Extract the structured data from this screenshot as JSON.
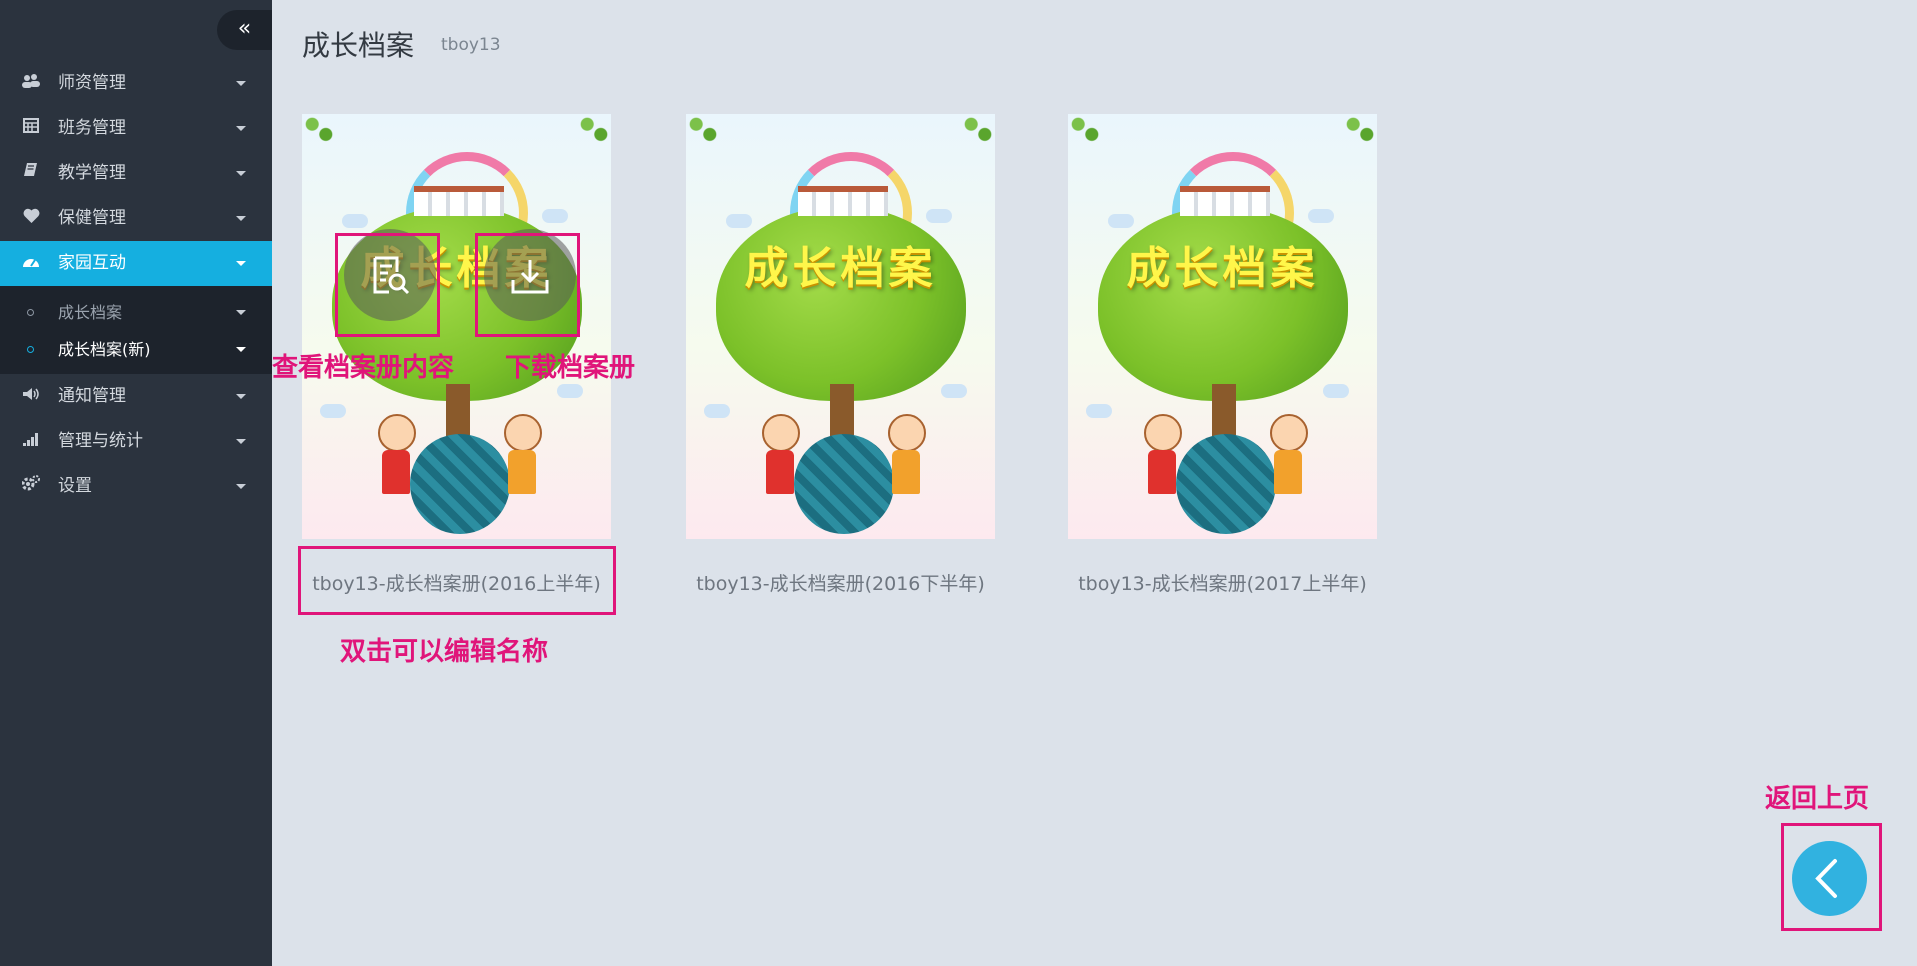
{
  "sidebar": {
    "collapse_glyph": "«",
    "items": [
      {
        "label": "师资管理",
        "icon": "users-icon"
      },
      {
        "label": "班务管理",
        "icon": "calendar-icon"
      },
      {
        "label": "教学管理",
        "icon": "book-icon"
      },
      {
        "label": "保健管理",
        "icon": "heart-icon"
      },
      {
        "label": "家园互动",
        "icon": "dashboard-icon",
        "active": true
      },
      {
        "label": "通知管理",
        "icon": "volume-icon"
      },
      {
        "label": "管理与统计",
        "icon": "signal-icon"
      },
      {
        "label": "设置",
        "icon": "gears-icon"
      }
    ],
    "submenu": [
      {
        "label": "成长档案"
      },
      {
        "label": "成长档案(新)",
        "current": true
      }
    ]
  },
  "header": {
    "title": "成长档案",
    "subtitle": "tboy13"
  },
  "albums": [
    {
      "cover_title": "成长档案",
      "name": "tboy13-成长档案册(2016上半年)"
    },
    {
      "cover_title": "成长档案",
      "name": "tboy13-成长档案册(2016下半年)"
    },
    {
      "cover_title": "成长档案",
      "name": "tboy13-成长档案册(2017上半年)"
    }
  ],
  "annotations": {
    "view_content": "查看档案册内容",
    "download": "下载档案册",
    "rename_hint": "双击可以编辑名称",
    "back": "返回上页"
  },
  "colors": {
    "sidebar_bg": "#2b333e",
    "active_accent": "#15afe0",
    "page_bg": "#dce2ea",
    "annotation": "#e0157a",
    "back_button": "#31b2e0"
  }
}
